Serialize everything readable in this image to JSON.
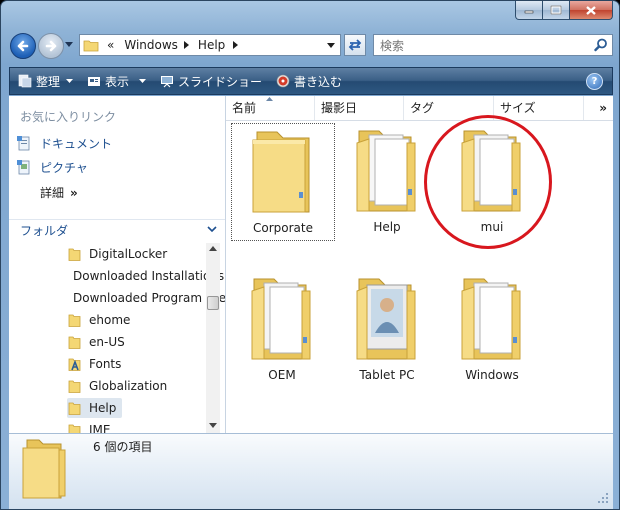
{
  "window": {
    "caption_buttons": [
      "minimize-icon",
      "maximize-icon",
      "close-icon"
    ]
  },
  "address_bar": {
    "prefix": "«",
    "path": [
      "Windows",
      "Help"
    ]
  },
  "search": {
    "placeholder": "検索"
  },
  "toolbar": {
    "organize_label": "整理",
    "views_label": "表示",
    "slideshow_label": "スライドショー",
    "burn_label": "書き込む"
  },
  "nav_pane": {
    "favorites_header": "お気に入りリンク",
    "favorites": [
      {
        "label": "ドキュメント",
        "icon": "documents-icon"
      },
      {
        "label": "ピクチャ",
        "icon": "pictures-icon"
      }
    ],
    "more_label": "詳細",
    "more_glyph": "»",
    "folders_header": "フォルダ",
    "tree": [
      {
        "label": "DigitalLocker",
        "icon": "folder-icon"
      },
      {
        "label": "Downloaded Installations",
        "icon": "folder-icon"
      },
      {
        "label": "Downloaded Program Files",
        "icon": "program-files-icon"
      },
      {
        "label": "ehome",
        "icon": "folder-icon"
      },
      {
        "label": "en-US",
        "icon": "folder-icon"
      },
      {
        "label": "Fonts",
        "icon": "fonts-folder-icon"
      },
      {
        "label": "Globalization",
        "icon": "folder-icon"
      },
      {
        "label": "Help",
        "icon": "folder-icon",
        "selected": true
      },
      {
        "label": "IME",
        "icon": "folder-icon"
      }
    ]
  },
  "columns": [
    "名前",
    "撮影日",
    "タグ",
    "サイズ"
  ],
  "columns_more": "»",
  "files": [
    {
      "label": "Corporate",
      "type": "folder",
      "focused": true
    },
    {
      "label": "Help",
      "type": "folder"
    },
    {
      "label": "mui",
      "type": "folder"
    },
    {
      "label": "OEM",
      "type": "folder"
    },
    {
      "label": "Tablet PC",
      "type": "folder-picture"
    },
    {
      "label": "Windows",
      "type": "folder"
    }
  ],
  "details": {
    "item_count": "6 個の項目"
  },
  "colors": {
    "annotation_circle": "#d8171e",
    "folder_yellow": "#f4d774",
    "link_blue": "#1d4f8f"
  }
}
